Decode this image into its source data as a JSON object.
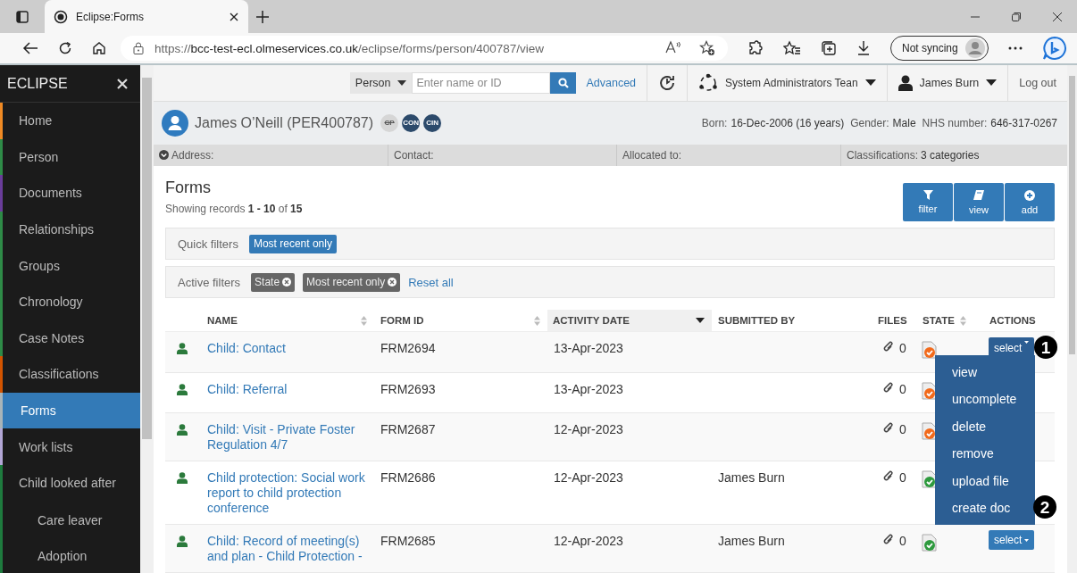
{
  "browser": {
    "tab_title": "Eclipse:Forms",
    "url": {
      "scheme": "https://",
      "host": "bcc-test-ecl.olmeservices.co.uk",
      "path": "/eclipse/forms/person/400787/view"
    },
    "sync_label": "Not syncing"
  },
  "sidebar": {
    "title": "ECLIPSE",
    "items": [
      {
        "label": "Home",
        "color": "#f08a24",
        "selected": false
      },
      {
        "label": "Person",
        "color": "#2e8b47",
        "selected": false
      },
      {
        "label": "Documents",
        "color": "#6a3d9a",
        "selected": false
      },
      {
        "label": "Relationships",
        "color": "#2e8b47",
        "selected": false
      },
      {
        "label": "Groups",
        "color": "#2e8b47",
        "selected": false
      },
      {
        "label": "Chronology",
        "color": "#2e8b47",
        "selected": false
      },
      {
        "label": "Case Notes",
        "color": "#2e8b47",
        "selected": false
      },
      {
        "label": "Classifications",
        "color": "#d35400",
        "selected": false
      },
      {
        "label": "Forms",
        "color": "#a9b4b8",
        "selected": true
      },
      {
        "label": "Work lists",
        "color": "#b3a7d6",
        "selected": false
      },
      {
        "label": "Child looked after",
        "color": "#1e7b3e",
        "selected": false,
        "children": [
          {
            "label": "Care leaver",
            "color": "#1e7b3e",
            "selected": false
          },
          {
            "label": "Adoption",
            "color": "#1e7b3e",
            "selected": false
          }
        ]
      }
    ]
  },
  "header": {
    "search_type": "Person",
    "search_placeholder": "Enter name or ID",
    "advanced": "Advanced",
    "team": "System Administrators Tean",
    "user": "James Burn",
    "logout": "Log out"
  },
  "person": {
    "name": "James O’Neill (PER400787)",
    "badges": [
      {
        "label": "CP",
        "active": false
      },
      {
        "label": "CON",
        "active": true
      },
      {
        "label": "CIN",
        "active": true
      }
    ],
    "details": [
      {
        "label": "Born:",
        "value": "16-Dec-2006 (16 years)"
      },
      {
        "label": "Gender:",
        "value": "Male"
      },
      {
        "label": "NHS number:",
        "value": "646-317-0267"
      }
    ]
  },
  "info_bar": [
    {
      "kind": "toggle",
      "label": "Address:"
    },
    {
      "kind": "field",
      "label": "Contact:"
    },
    {
      "kind": "field",
      "label": "Allocated to:"
    },
    {
      "kind": "field",
      "label": "Classifications:",
      "value": "3 categories"
    }
  ],
  "forms": {
    "title": "Forms",
    "count": "Showing records **1 - 10** of **15**",
    "toolbar": [
      {
        "label": "filter"
      },
      {
        "label": "view"
      },
      {
        "label": "add"
      }
    ],
    "quick_filters": {
      "label": "Quick filters",
      "chips": [
        {
          "label": "Most recent only",
          "selected": true
        }
      ]
    },
    "active_filters": {
      "label": "Active filters",
      "chips": [
        {
          "label": "State"
        },
        {
          "label": "Most recent only"
        }
      ],
      "reset": "Reset all"
    },
    "table": {
      "columns": [
        {
          "label": "NAME",
          "sortable": true,
          "sorted": false
        },
        {
          "label": "FORM ID",
          "sortable": true,
          "sorted": false
        },
        {
          "label": "ACTIVITY DATE",
          "sorted": true
        },
        {
          "label": "SUBMITTED BY",
          "sortable": false,
          "sorted": false
        },
        {
          "label": "FILES",
          "sortable": false,
          "sorted": false
        },
        {
          "label": "STATE",
          "sortable": true,
          "sorted": false
        },
        {
          "label": "ACTIONS",
          "sortable": false,
          "sorted": false
        }
      ],
      "rows": [
        {
          "name": "Child: Contact",
          "form_id": "FRM2694",
          "date": "13-Apr-2023",
          "files": "0",
          "complete": false,
          "action": {
            "label": "select",
            "open": true
          }
        },
        {
          "name": "Child: Referral",
          "form_id": "FRM2693",
          "date": "13-Apr-2023",
          "files": "0",
          "complete": false
        },
        {
          "name": "Child: Visit - Private Foster Regulation 4/7",
          "form_id": "FRM2687",
          "date": "12-Apr-2023",
          "files": "0",
          "complete": false
        },
        {
          "name": "Child protection: Social work report to child protection conference",
          "form_id": "FRM2686",
          "date": "12-Apr-2023",
          "submitted_by": "James Burn",
          "files": "0",
          "complete": true
        },
        {
          "name": "Child: Record of meeting(s) and plan - Child Protection -",
          "form_id": "FRM2685",
          "date": "12-Apr-2023",
          "submitted_by": "James Burn",
          "files": "0",
          "complete": true,
          "action": {
            "label": "select",
            "open": false
          }
        }
      ]
    },
    "menu": {
      "items": [
        "view",
        "uncomplete",
        "delete",
        "remove",
        "upload file",
        "create doc"
      ]
    },
    "callouts": [
      "1",
      "2"
    ]
  }
}
